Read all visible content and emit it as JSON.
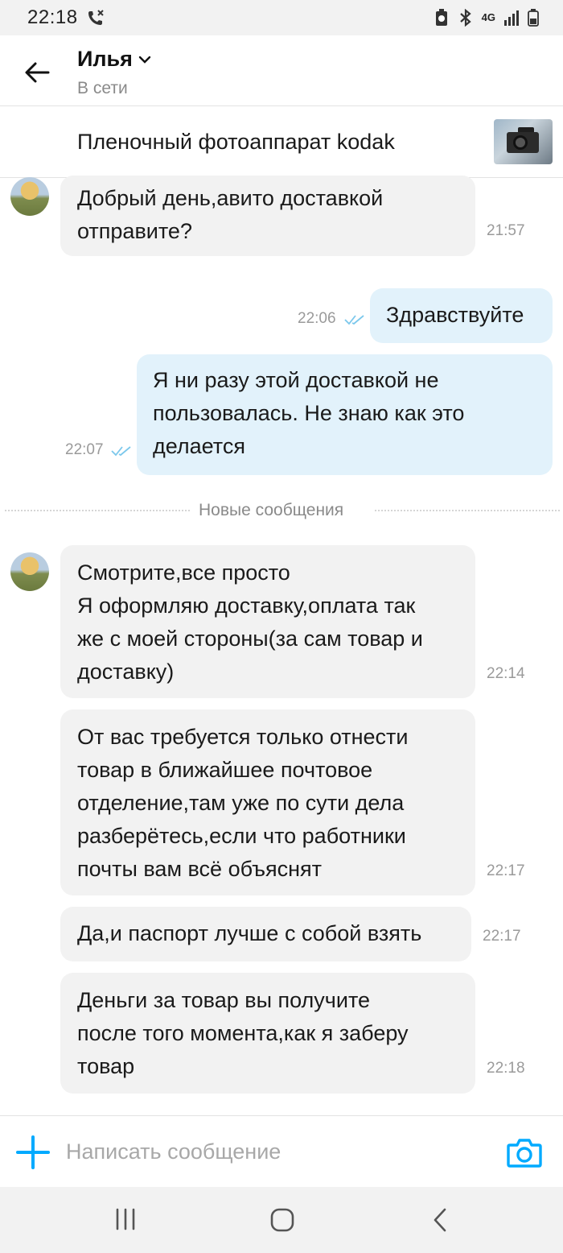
{
  "status_bar": {
    "time": "22:18",
    "network": "4G"
  },
  "header": {
    "contact_name": "Илья",
    "contact_status": "В сети"
  },
  "item": {
    "title": "Пленочный фотоаппарат kodak"
  },
  "messages": [
    {
      "direction": "in",
      "lines": [
        "Добрый день,авито доставкой",
        "отправите?"
      ],
      "time": "21:57"
    },
    {
      "direction": "out",
      "lines": [
        "Здравствуйте"
      ],
      "time": "22:06",
      "read": true
    },
    {
      "direction": "out",
      "lines": [
        "Я ни разу этой доставкой не",
        "пользовалась. Не знаю как это",
        "делается"
      ],
      "time": "22:07",
      "read": true
    },
    {
      "direction": "in",
      "lines": [
        "Смотрите,все просто",
        "Я оформляю доставку,оплата так",
        "же с моей стороны(за сам товар и",
        "доставку)"
      ],
      "time": "22:14"
    },
    {
      "direction": "in",
      "lines": [
        "От вас требуется только отнести",
        "товар в ближайшее почтовое",
        "отделение,там уже по сути дела",
        "разберётесь,если что работники",
        "почты вам всё объяснят"
      ],
      "time": "22:17"
    },
    {
      "direction": "in",
      "lines": [
        "Да,и паспорт лучше с собой взять"
      ],
      "time": "22:17"
    },
    {
      "direction": "in",
      "lines": [
        "Деньги за товар вы получите",
        "после того момента,как я заберу",
        "товар"
      ],
      "time": "22:18"
    }
  ],
  "divider": {
    "label": "Новые сообщения"
  },
  "composer": {
    "placeholder": "Написать сообщение"
  },
  "colors": {
    "accent": "#00aaff",
    "incoming_bubble": "#f2f2f2",
    "outgoing_bubble": "#e2f2fb",
    "read_check": "#7cc8ec"
  }
}
